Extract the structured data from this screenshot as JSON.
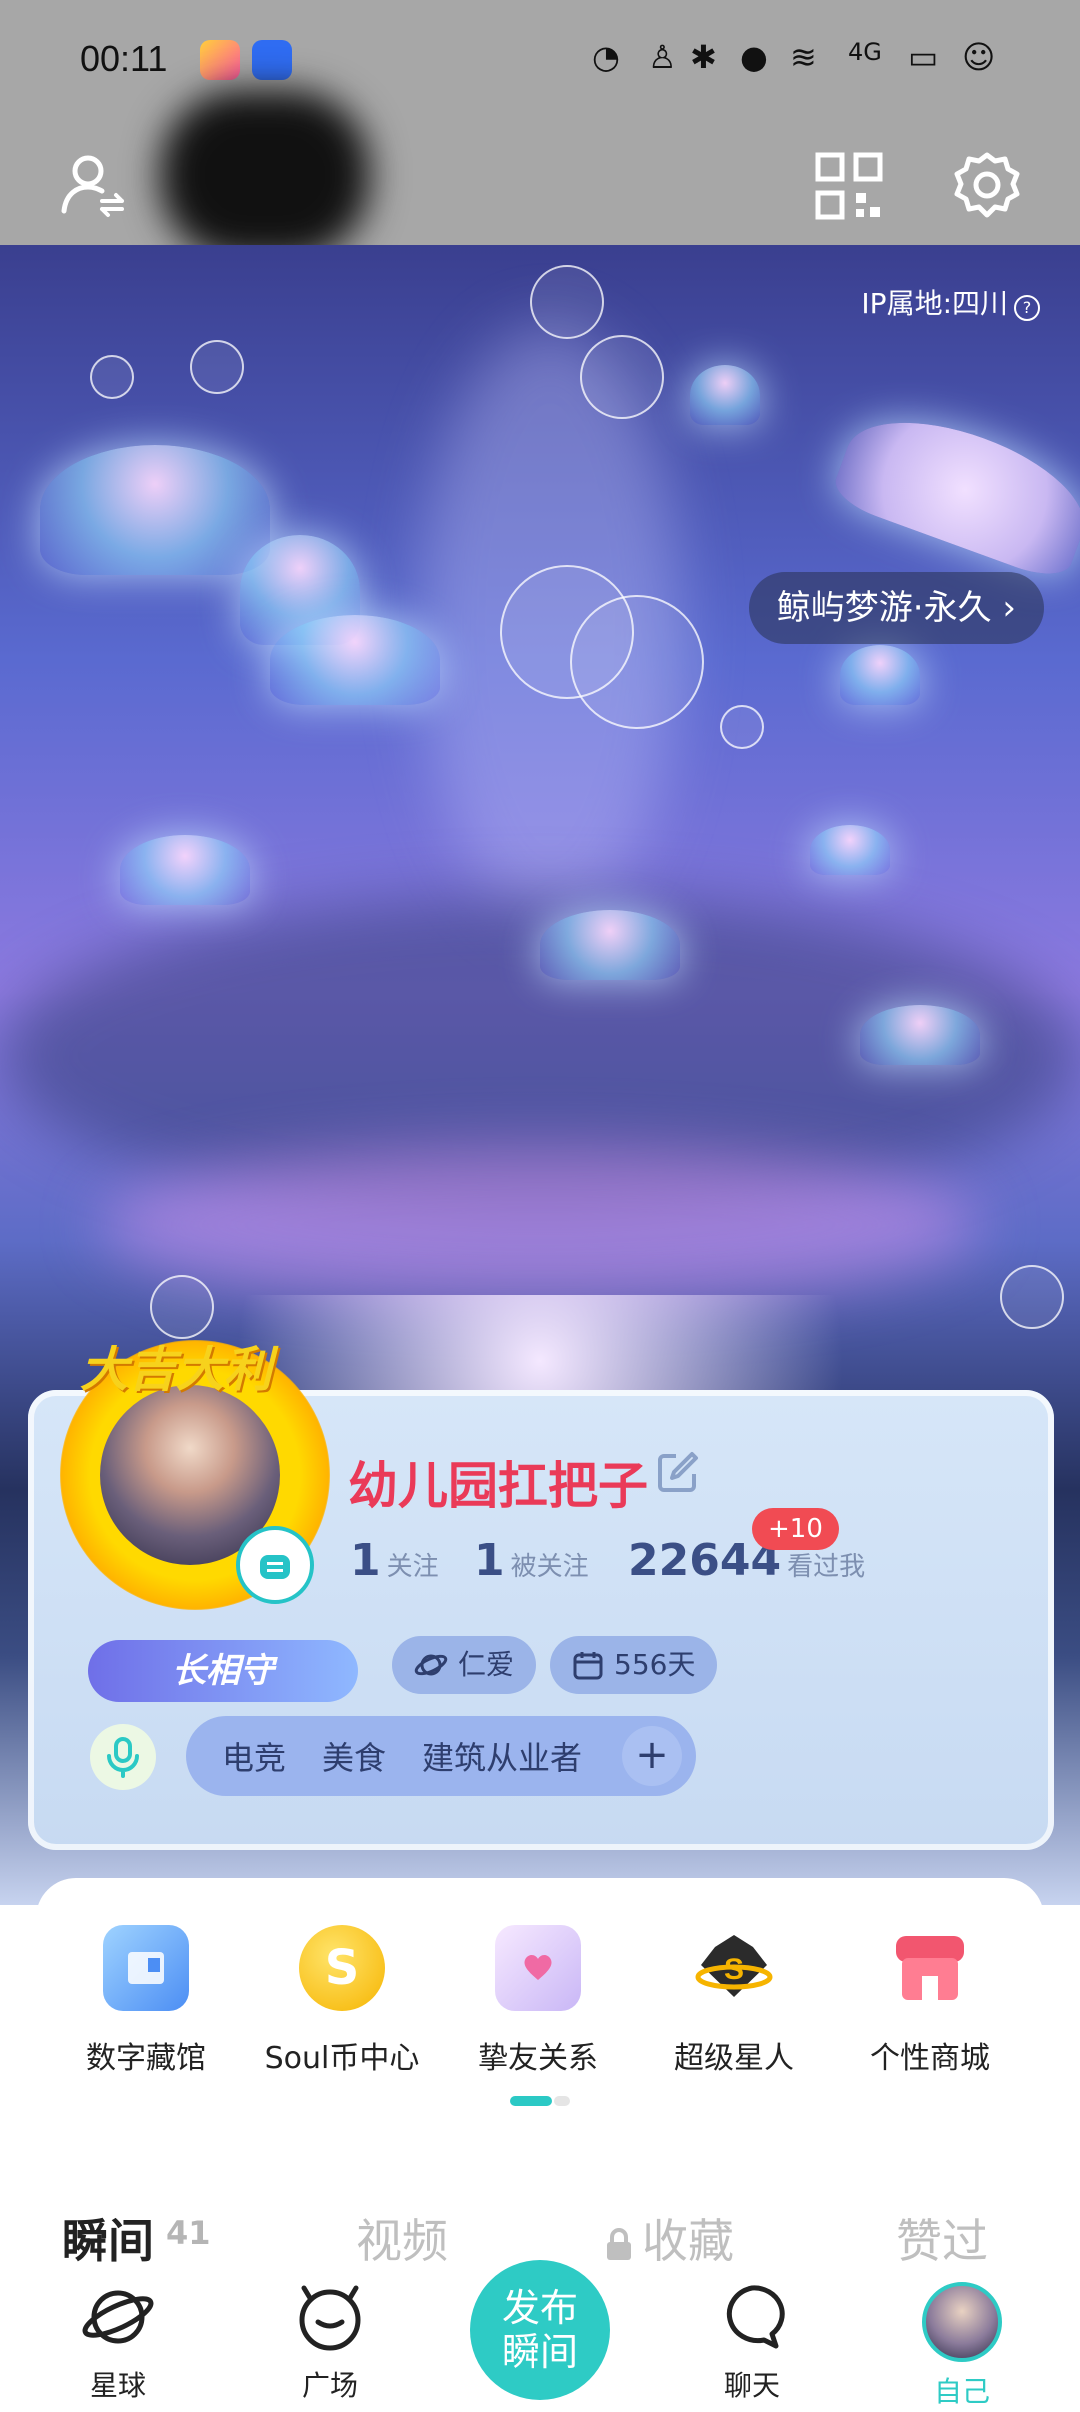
{
  "status_bar": {
    "time": "00:11",
    "network": "4G"
  },
  "profile": {
    "ip_location": "IP属地:四川",
    "theme_badge": "鲸屿梦游·永久",
    "avatar_frame_text": "大吉大利",
    "username": "幼儿园扛把子",
    "following_count": "1",
    "following_label": "关注",
    "followers_count": "1",
    "followers_label": "被关注",
    "views_count": "22644",
    "views_label": "看过我",
    "views_new": "+10",
    "guard_label": "长相守",
    "trait_chip": "仁爱",
    "days_chip": "556天",
    "tags": [
      "电竞",
      "美食",
      "建筑从业者"
    ],
    "tag_add": "+"
  },
  "functions": [
    {
      "label": "数字藏馆",
      "icon": "digital-museum-icon"
    },
    {
      "label": "Soul币中心",
      "icon": "soul-coin-icon"
    },
    {
      "label": "挚友关系",
      "icon": "friendship-envelope-icon"
    },
    {
      "label": "超级星人",
      "icon": "super-star-icon"
    },
    {
      "label": "个性商城",
      "icon": "shop-icon"
    }
  ],
  "content_tabs": [
    {
      "label": "瞬间",
      "count": "41"
    },
    {
      "label": "视频"
    },
    {
      "label": "收藏"
    },
    {
      "label": "赞过"
    }
  ],
  "bottom_nav": {
    "planet": "星球",
    "square": "广场",
    "publish_line1": "发布",
    "publish_line2": "瞬间",
    "chat": "聊天",
    "me": "自己"
  },
  "colors": {
    "accent": "#2ecbc5",
    "username": "#ea3a58",
    "badge": "#f14b53"
  }
}
